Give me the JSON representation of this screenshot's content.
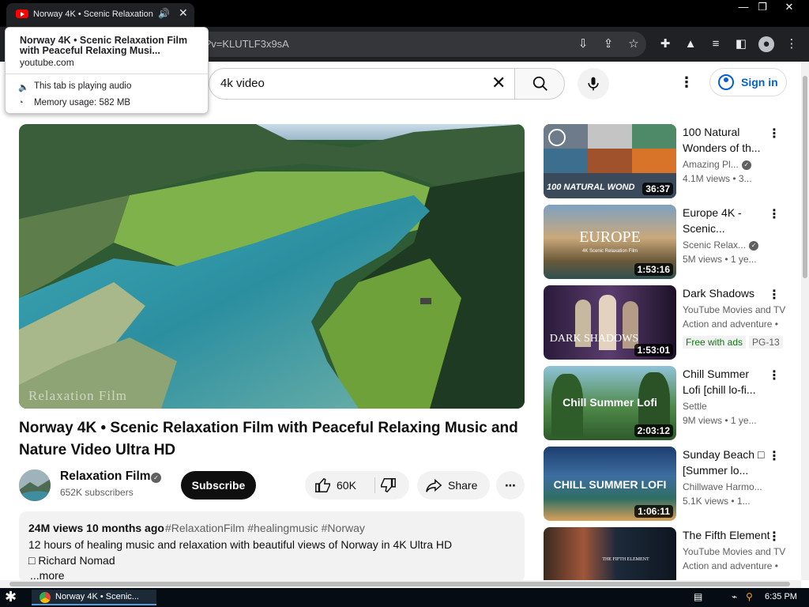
{
  "browser": {
    "tab_title": "Norway 4K • Scenic Relaxation",
    "address_fragment": "?v=KLUTLF3x9sA",
    "hover_card": {
      "title": "Norway 4K • Scenic Relaxation Film with Peaceful Relaxing Musi...",
      "domain": "youtube.com",
      "audio_status": "This tab is playing audio",
      "memory": "Memory usage: 582 MB"
    }
  },
  "youtube": {
    "search_query": "4k video",
    "sign_in_label": "Sign in"
  },
  "video": {
    "watermark": "Relaxation Film",
    "title": "Norway 4K • Scenic Relaxation Film with Peaceful Relaxing Music and Nature Video Ultra HD",
    "channel": "Relaxation Film",
    "verified_mark": "✓",
    "subscribers": "652K subscribers",
    "subscribe_label": "Subscribe",
    "likes": "60K",
    "share_label": "Share",
    "more_label": "⋯",
    "views_age": "24M views  10 months ago",
    "hashtags": "#RelaxationFilm #healingmusic #Norway",
    "desc_line1": "12 hours of healing music and relaxation with beautiful views of Norway in 4K Ultra HD",
    "desc_line2": "□ Richard Nomad",
    "desc_more": "...more"
  },
  "recommendations": [
    {
      "title": "100 Natural Wonders of th...",
      "channel": "Amazing Pl...",
      "meta": "4.1M views  • 3...",
      "duration": "36:37",
      "thumb_text": "100 NATURAL WOND",
      "verified": true
    },
    {
      "title": "Europe 4K - Scenic...",
      "channel": "Scenic Relax...",
      "meta": "5M views  • 1 ye...",
      "duration": "1:53:16",
      "thumb_text": "EUROPE",
      "thumb_sub": "4K Scenic Relaxation Film",
      "verified": true
    },
    {
      "title": "Dark Shadows",
      "channel": "YouTube Movies and TV",
      "meta": "Action and adventure •",
      "duration": "1:53:01",
      "thumb_text": "DARK SHADOWS",
      "badge1": "Free with ads",
      "badge2": "PG-13"
    },
    {
      "title": "Chill Summer Lofi [chill lo-fi...",
      "channel": "Settle",
      "meta": "9M views  • 1 ye...",
      "duration": "2:03:12",
      "thumb_text": "Chill Summer Lofi"
    },
    {
      "title": "Sunday Beach □ [Summer lo...",
      "channel": "Chillwave Harmo...",
      "meta": "5.1K views  • 1...",
      "duration": "1:06:11",
      "thumb_text": "CHILL SUMMER LOFI"
    },
    {
      "title": "The Fifth Element",
      "channel": "YouTube Movies and TV",
      "meta": "Action and adventure •",
      "thumb_text": "THE FIFTH ELEMENT"
    }
  ],
  "taskbar": {
    "window_label": "Norway 4K • Scenic...",
    "clock": "6:35 PM"
  }
}
